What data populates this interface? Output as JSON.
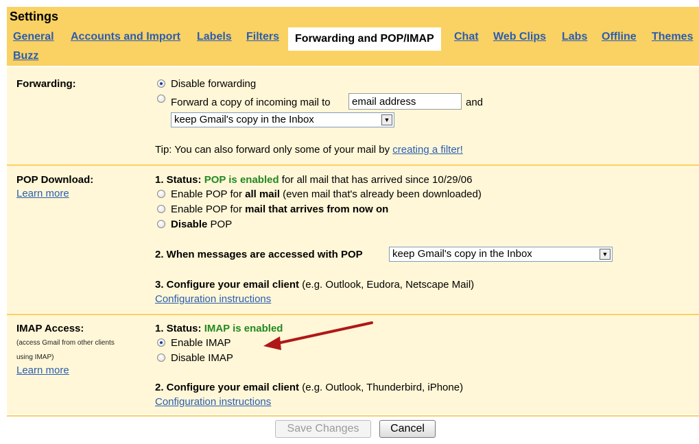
{
  "header": {
    "title": "Settings",
    "tabs": [
      "General",
      "Accounts and Import",
      "Labels",
      "Filters",
      "Forwarding and POP/IMAP",
      "Chat",
      "Web Clips",
      "Labs",
      "Offline",
      "Themes",
      "Buzz"
    ],
    "active_tab": "Forwarding and POP/IMAP"
  },
  "forwarding": {
    "label": "Forwarding:",
    "disable_label": "Disable forwarding",
    "forward_label": "Forward a copy of incoming mail to",
    "email_value": "email address",
    "and_label": "and",
    "copy_select": "keep Gmail's copy in the Inbox",
    "tip_prefix": "Tip: You can also forward only some of your mail by ",
    "tip_link": "creating a filter!"
  },
  "pop": {
    "label": "POP Download:",
    "learn_more": "Learn more",
    "status_prefix": "1. Status: ",
    "status_value": "POP is enabled",
    "status_suffix": " for all mail that has arrived since 10/29/06",
    "opt1_prefix": "Enable POP for ",
    "opt1_bold": "all mail",
    "opt1_suffix": " (even mail that's already been downloaded)",
    "opt2_prefix": "Enable POP for ",
    "opt2_bold": "mail that arrives from now on",
    "opt3_bold": "Disable",
    "opt3_suffix": " POP",
    "when_label": "2. When messages are accessed with POP",
    "when_select": "keep Gmail's copy in the Inbox",
    "configure_bold": "3. Configure your email client",
    "configure_suffix": " (e.g. Outlook, Eudora, Netscape Mail)",
    "config_link": "Configuration instructions"
  },
  "imap": {
    "label": "IMAP Access:",
    "note_line1": "(access Gmail from other clients",
    "note_line2": "using IMAP)",
    "learn_more": "Learn more",
    "status_prefix": "1. Status: ",
    "status_value": "IMAP is enabled",
    "enable_label": "Enable IMAP",
    "disable_label": "Disable IMAP",
    "configure_bold": "2. Configure your email client",
    "configure_suffix": " (e.g. Outlook, Thunderbird, iPhone)",
    "config_link": "Configuration instructions"
  },
  "footer": {
    "save_label": "Save Changes",
    "cancel_label": "Cancel"
  },
  "colors": {
    "header_bg": "#fad163",
    "section_bg": "#fff7d7",
    "link": "#2a5db0",
    "status_green": "#228822",
    "annotation_arrow": "#b01818"
  }
}
